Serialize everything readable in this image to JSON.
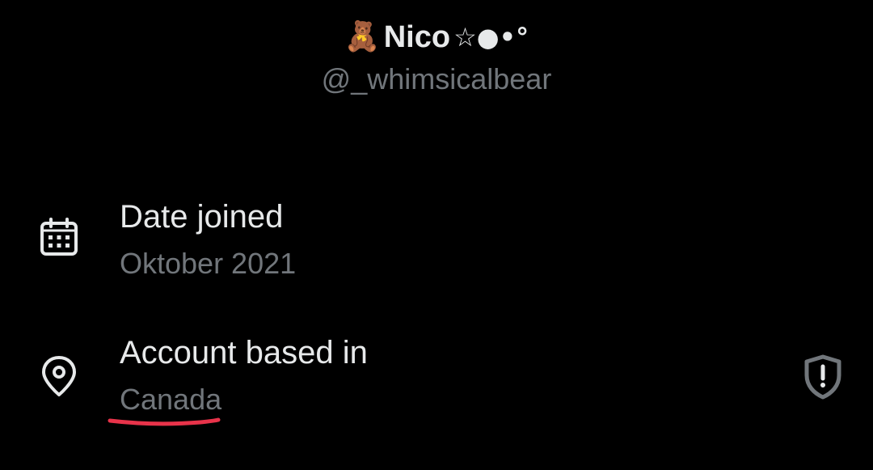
{
  "profile": {
    "emoji": "🧸",
    "name": "Nico",
    "decor": "☆●•°",
    "handle": "@_whimsicalbear"
  },
  "rows": [
    {
      "icon": "calendar-icon",
      "title": "Date joined",
      "value": "Oktober 2021"
    },
    {
      "icon": "location-pin-icon",
      "title": "Account based in",
      "value": "Canada",
      "trailing_icon": "shield-alert-icon"
    }
  ],
  "colors": {
    "background": "#000000",
    "primary_text": "#e7e9ea",
    "secondary_text": "#71767b",
    "annotation_underline": "#e8334a"
  }
}
